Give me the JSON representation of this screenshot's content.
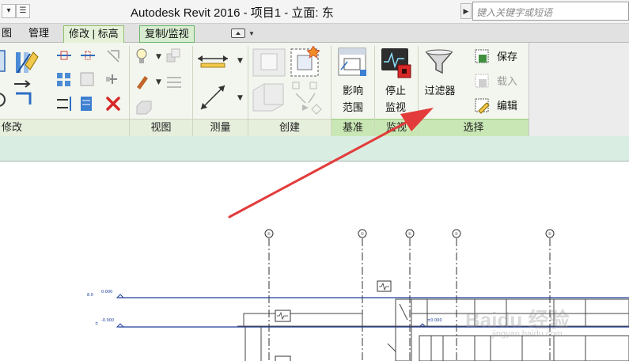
{
  "title_bar": {
    "quick_access_btn1": "▾",
    "quick_access_btn2": "☰",
    "app_title": "Autodesk Revit 2016 -     项目1 - 立面: 东",
    "search_arrow": "▶",
    "search_placeholder": "键入关键字或短语"
  },
  "tabs": [
    {
      "label": "图"
    },
    {
      "label": "管理"
    },
    {
      "label": "修改 | 标高"
    },
    {
      "label": "复制/监视"
    }
  ],
  "ribbon": {
    "panels": [
      {
        "label": "修改"
      },
      {
        "label": "视图"
      },
      {
        "label": "测量"
      },
      {
        "label": "创建"
      },
      {
        "label": "基准"
      },
      {
        "label": "监视"
      },
      {
        "label": "选择"
      }
    ],
    "buttons": {
      "scope_box": "影响\n范围",
      "stop_monitor": "停止\n监视",
      "filter": "过滤器",
      "save": "保存",
      "load": "载入",
      "edit": "编辑"
    }
  },
  "drawing": {
    "grid_bubbles": [
      "①",
      "①",
      "①",
      "①",
      "①"
    ],
    "level_tags": [
      "0.000",
      "-0.000",
      "±0.000"
    ]
  },
  "watermark": {
    "text": "Baidu 经验",
    "url": "jingyan.baidu.com"
  },
  "colors": {
    "ribbon_bg": "#f3f6ee",
    "context_tab": "#d8ecd0",
    "options_bar": "#d9ede3",
    "level_line": "#1f3d9a",
    "arrow": "#e33b3b"
  }
}
